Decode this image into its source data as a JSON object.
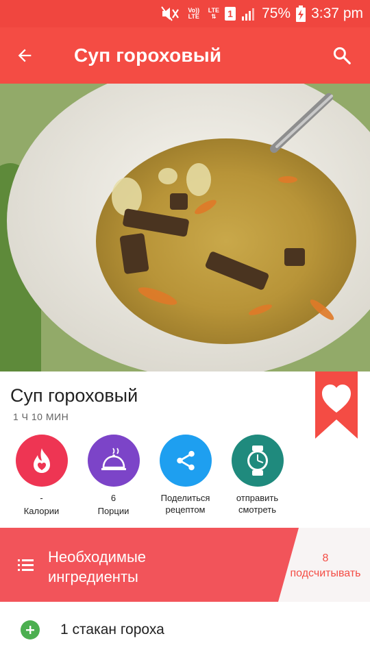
{
  "status_bar": {
    "battery": "75%",
    "time": "3:37 pm",
    "volte_label": "Vo)) LTE",
    "lte_label": "LTE",
    "sim_number": "1"
  },
  "app_bar": {
    "title": "Суп гороховый"
  },
  "recipe": {
    "title": "Суп гороховый",
    "time": "1 Ч 10 МИН"
  },
  "actions": [
    {
      "value": "-",
      "label": "Калории"
    },
    {
      "value": "6",
      "label": "Порции"
    },
    {
      "label": "Поделиться рецептом",
      "line1": "Поделиться",
      "line2": "рецептом"
    },
    {
      "label": "отправить смотреть",
      "line1": "отправить",
      "line2": "смотреть"
    }
  ],
  "ingredients_header": {
    "title_line1": "Необходимые",
    "title_line2": "ингредиенты",
    "count": "8",
    "count_label": "подсчитывать"
  },
  "ingredients": [
    {
      "text": "1 стакан гороха"
    }
  ],
  "colors": {
    "primary": "#f44c44",
    "status_bar": "#f0463f",
    "calories": "#ee3553",
    "portions": "#7c44c8",
    "share": "#1e9ff0",
    "watch": "#1f8a7d",
    "add": "#4caf50"
  }
}
